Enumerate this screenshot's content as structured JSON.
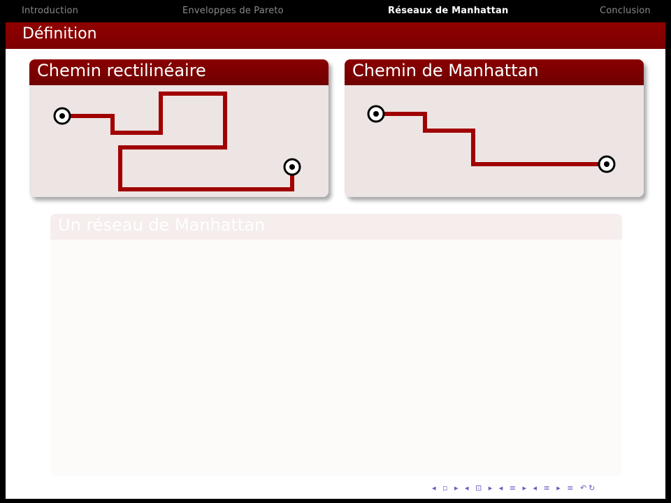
{
  "navbar": {
    "items": [
      {
        "label": "Introduction",
        "active": false
      },
      {
        "label": "Enveloppes de Pareto",
        "active": false
      },
      {
        "label": "Réseaux de Manhattan",
        "active": true
      },
      {
        "label": "Conclusion",
        "active": false
      }
    ]
  },
  "frame": {
    "title": "Définition"
  },
  "blocks": {
    "rectilinear": {
      "title": "Chemin rectilinéaire"
    },
    "manhattan": {
      "title": "Chemin de Manhattan"
    },
    "network": {
      "title": "Un réseau de Manhattan"
    }
  },
  "colors": {
    "accent": "#8b0000",
    "path": "#a00000",
    "block_body": "#ede4e4",
    "nav_symbols": "#6a5ac0"
  },
  "footer": {
    "nav_symbols": "◂ ▫ ▸ ◂ ⊡ ▸ ◂ ≡ ▸ ◂ ≡ ▸ ≡ ↶↻"
  }
}
